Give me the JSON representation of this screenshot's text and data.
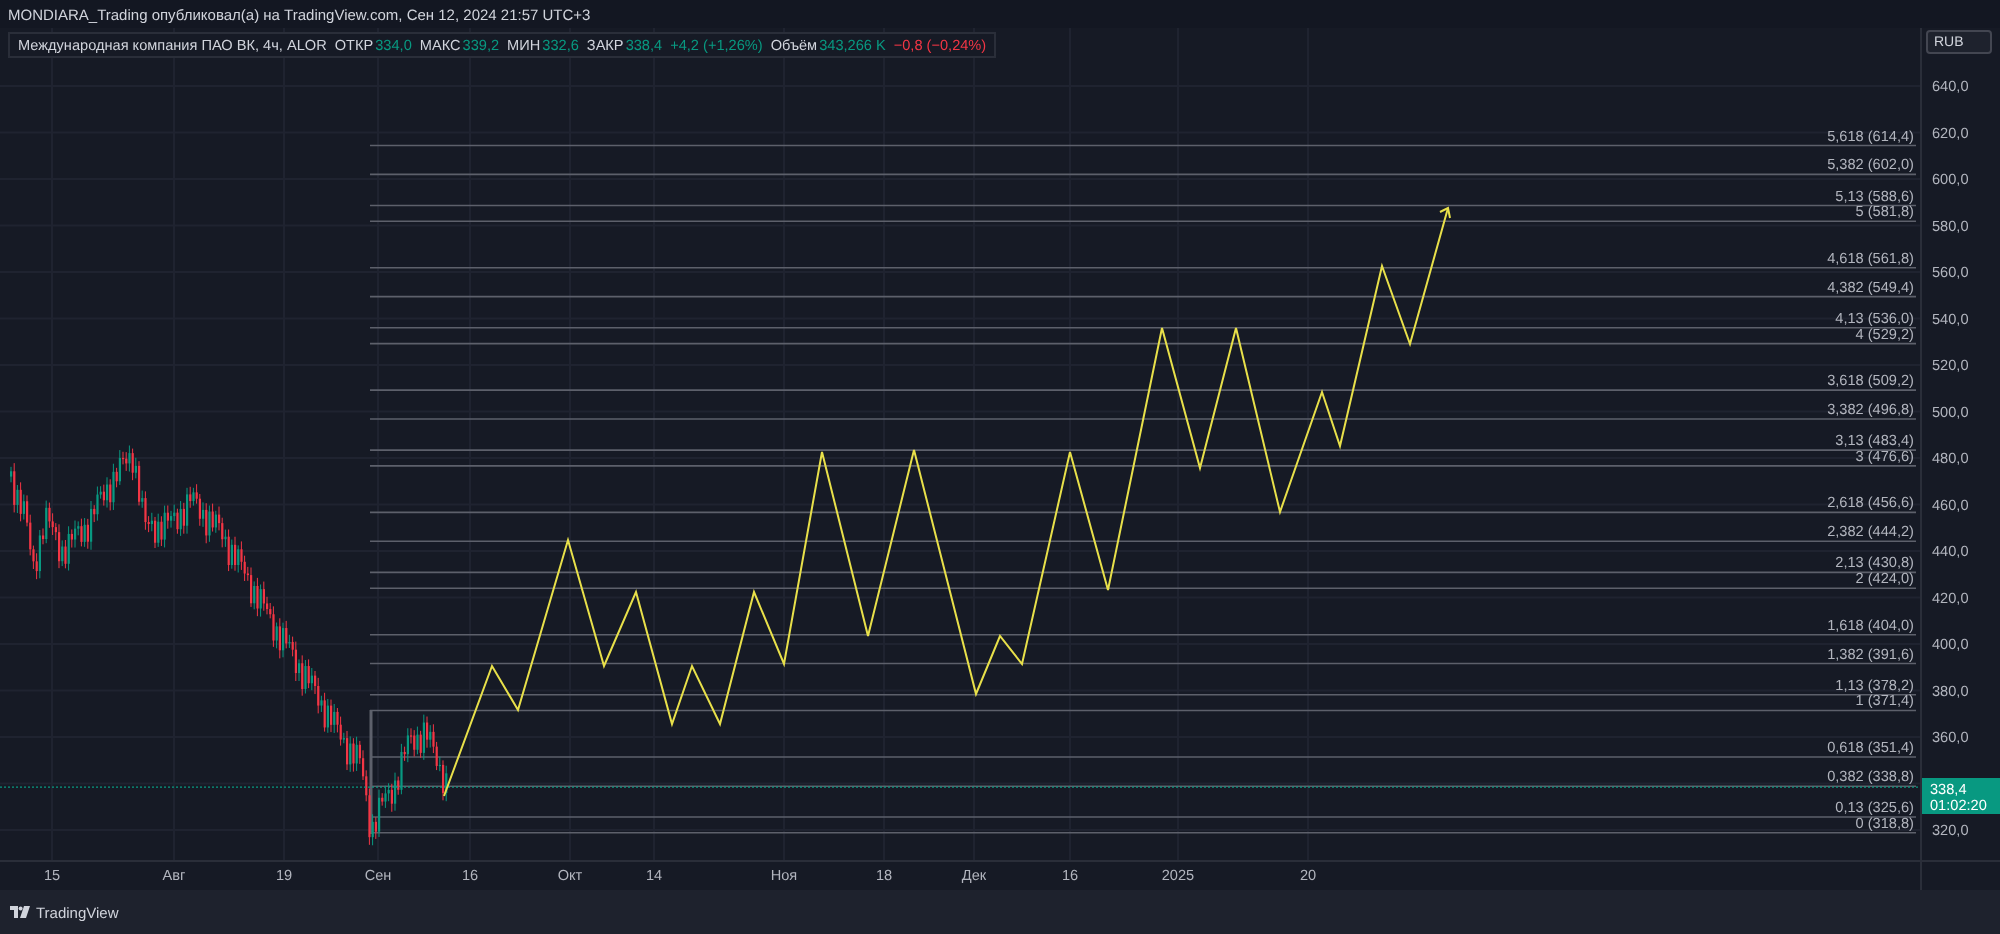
{
  "header": {
    "title": "MONDIARA_Trading опубликовал(а) на TradingView.com, Сен 12, 2024 21:57 UTC+3"
  },
  "legend": {
    "symbol": "Международная компания ПАО ВК, 4ч, ALOR",
    "fields": [
      {
        "label": "ОТКР",
        "value": "334,0"
      },
      {
        "label": "МАКС",
        "value": "339,2"
      },
      {
        "label": "МИН",
        "value": "332,6"
      },
      {
        "label": "ЗАКР",
        "value": "338,4"
      }
    ],
    "change": {
      "text": "+4,2 (+1,26%)",
      "kind": "up"
    },
    "volume": {
      "label": "Объём",
      "value": "343,266 K"
    },
    "volume_change": {
      "text": "−0,8 (−0,24%)",
      "kind": "down"
    }
  },
  "currency_button": "RUB",
  "price_axis": [
    "640,0",
    "620,0",
    "600,0",
    "580,0",
    "560,0",
    "540,0",
    "520,0",
    "500,0",
    "480,0",
    "460,0",
    "440,0",
    "420,0",
    "400,0",
    "380,0",
    "360,0",
    "320,0"
  ],
  "fib_levels": [
    "5,618 (614,4)",
    "5,382 (602,0)",
    "5,13 (588,6)",
    "5 (581,8)",
    "4,618 (561,8)",
    "4,382 (549,4)",
    "4,13 (536,0)",
    "4 (529,2)",
    "3,618 (509,2)",
    "3,382 (496,8)",
    "3,13 (483,4)",
    "3 (476,6)",
    "2,618 (456,6)",
    "2,382 (444,2)",
    "2,13 (430,8)",
    "2 (424,0)",
    "1,618 (404,0)",
    "1,382 (391,6)",
    "1,13 (378,2)",
    "1 (371,4)",
    "0,618 (351,4)",
    "0,382 (338,8)",
    "0,13 (325,6)",
    "0 (318,8)"
  ],
  "current_price": {
    "value": "338,4",
    "countdown": "01:02:20"
  },
  "time_axis": [
    "15",
    "Авг",
    "19",
    "Сен",
    "16",
    "Окт",
    "14",
    "Ноя",
    "18",
    "Дек",
    "16",
    "2025",
    "20"
  ],
  "footer": {
    "brand": "TradingView"
  }
}
